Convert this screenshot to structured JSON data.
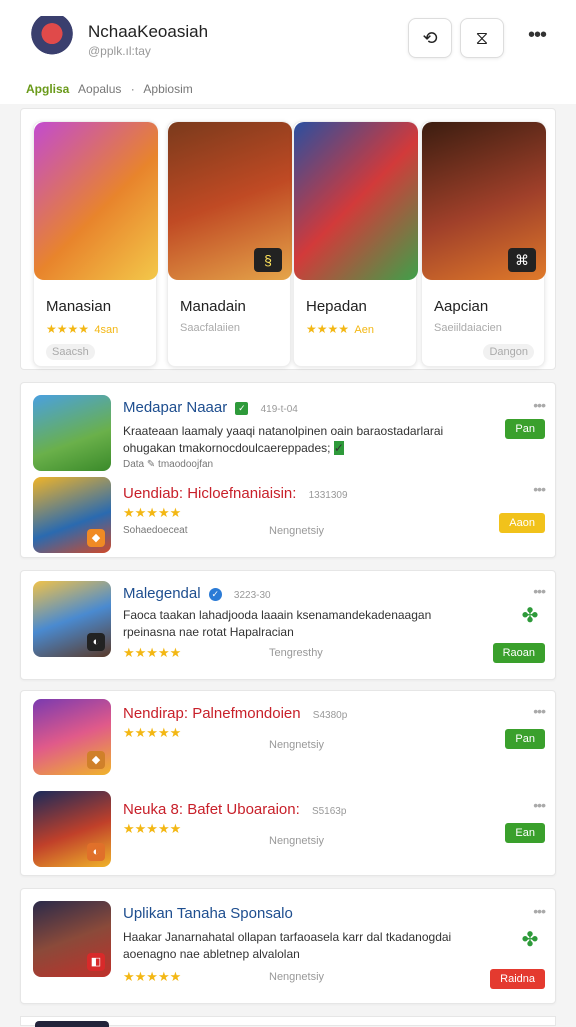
{
  "header": {
    "title": "NchaaKeoasiah",
    "subtitle": "@pplk.ıl:tay",
    "history_icon": "history-icon",
    "bookmark_icon": "bookmark-icon",
    "more_icon": "more-icon"
  },
  "breadcrumb": [
    "Apglisa",
    "Aopalus",
    "Apbiosim"
  ],
  "featured": [
    {
      "name": "Manasian",
      "rating_stars": "★★★★",
      "rating_text": "4san",
      "pill": "Saacsh",
      "pill_side": "left"
    },
    {
      "name": "Manadain",
      "sub": "Saacfalaiien"
    },
    {
      "name": "Hepadan",
      "rating_stars": "★★★★",
      "rating_text": "Aen"
    },
    {
      "name": "Aapcian",
      "sub": "Saeiildaiacien",
      "pill": "Dangon",
      "pill_side": "right"
    }
  ],
  "groups": [
    {
      "rows": [
        {
          "title": "Medapar Naaar",
          "title_color": "blue",
          "check": "✓",
          "check_color": "#2e9a3a",
          "meta": "419-t-04",
          "desc": "Kraateaan laamaly yaaqi natanolpinen oain baraostadarlarai ohugakan tmakornocdoulcaereppades;",
          "desc_check": "✓",
          "small": "Data  ✎  tmaodoojfan",
          "button": "Pan",
          "button_color": "#3aa02c"
        },
        {
          "title": "Uendiab: Hicloefnaniaisin:",
          "title_color": "red",
          "meta": "1331309",
          "stars": "★★★★★",
          "small": "Sohaedoeceat",
          "mid": "Nengnetsiy",
          "button": "Aaon",
          "button_color": "#f1c21b"
        }
      ]
    },
    {
      "rows": [
        {
          "title": "Malegendal",
          "title_color": "blue",
          "check": "✓",
          "check_color": "#2b7bd6",
          "meta": "3223-30",
          "desc": "Faoca taakan lahadjooda laaain ksenamandekadenaagan rpeinasna nae rotat Hapalracian",
          "stars": "★★★★★",
          "mid": "Tengresthy",
          "button": "Raoan",
          "button_color": "#3aa02c",
          "leaf": true
        }
      ]
    },
    {
      "rows": [
        {
          "title": "Nendirap: Palnefmondoien",
          "title_color": "red",
          "meta": "S4380p",
          "stars": "★★★★★",
          "mid": "Nengnetsiy",
          "button": "Pan",
          "button_color": "#3aa02c"
        },
        {
          "title": "Neuka 8: Bafet Uboaraion:",
          "title_color": "red",
          "meta": "S5163p",
          "stars": "★★★★★",
          "mid": "Nengnetsiy",
          "button": "Ean",
          "button_color": "#3aa02c"
        }
      ]
    },
    {
      "rows": [
        {
          "title": "Uplikan Tanaha Sponsalo",
          "title_color": "blue",
          "desc": "Haakar Janarnahatal ollapan tarfaoasela karr dal tkadanogdai aoenagno nae abletnep alvalolan",
          "stars": "★★★★★",
          "mid": "Nengnetsiy",
          "button": "Raidna",
          "button_color": "#e43a2f",
          "leaf": true
        }
      ]
    }
  ]
}
